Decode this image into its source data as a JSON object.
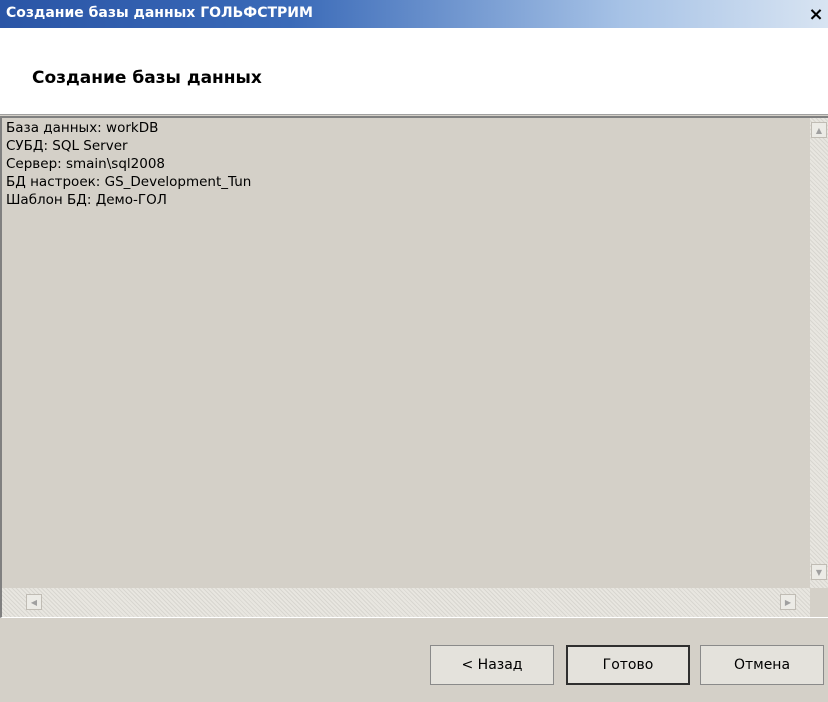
{
  "window": {
    "title": "Создание базы данных ГОЛЬФСТРИМ",
    "close_glyph": "×"
  },
  "header": {
    "title": "Создание базы данных"
  },
  "log": {
    "lines": [
      "База данных: workDB",
      "СУБД: SQL Server",
      "Сервер: smain\\sql2008",
      "БД настроек: GS_Development_Tun",
      "Шаблон БД: Демо-ГОЛ"
    ]
  },
  "scroll": {
    "up_glyph": "▲",
    "down_glyph": "▼",
    "left_glyph": "◀",
    "right_glyph": "▶"
  },
  "buttons": {
    "back_label": "< Назад",
    "finish_label": "Готово",
    "cancel_label": "Отмена"
  }
}
